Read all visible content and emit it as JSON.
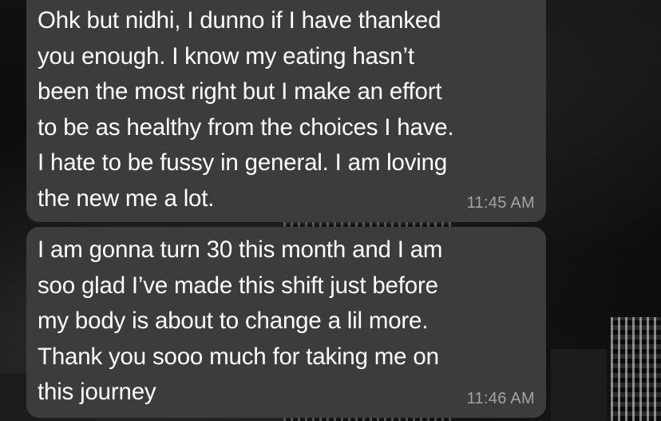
{
  "chat": {
    "messages": [
      {
        "text": "Ohk but nidhi, I dunno if I have thanked\nyou enough. I know my eating hasn’t\nbeen the most right but I make an effort\nto be as healthy from the choices I have.\nI hate to be fussy in general. I am loving\nthe new me a lot.",
        "time": "11:45 AM"
      },
      {
        "text": "I am gonna turn 30 this month and I am\nsoo glad I’ve made this shift just before\nmy body is about to change a lil more.\nThank you sooo much for taking me on\nthis journey",
        "time": "11:46 AM"
      }
    ]
  },
  "colors": {
    "bubble": "#3c3c3e",
    "text": "#ffffff",
    "timestamp": "#a3a3a6",
    "background": "#0d0d0d"
  }
}
